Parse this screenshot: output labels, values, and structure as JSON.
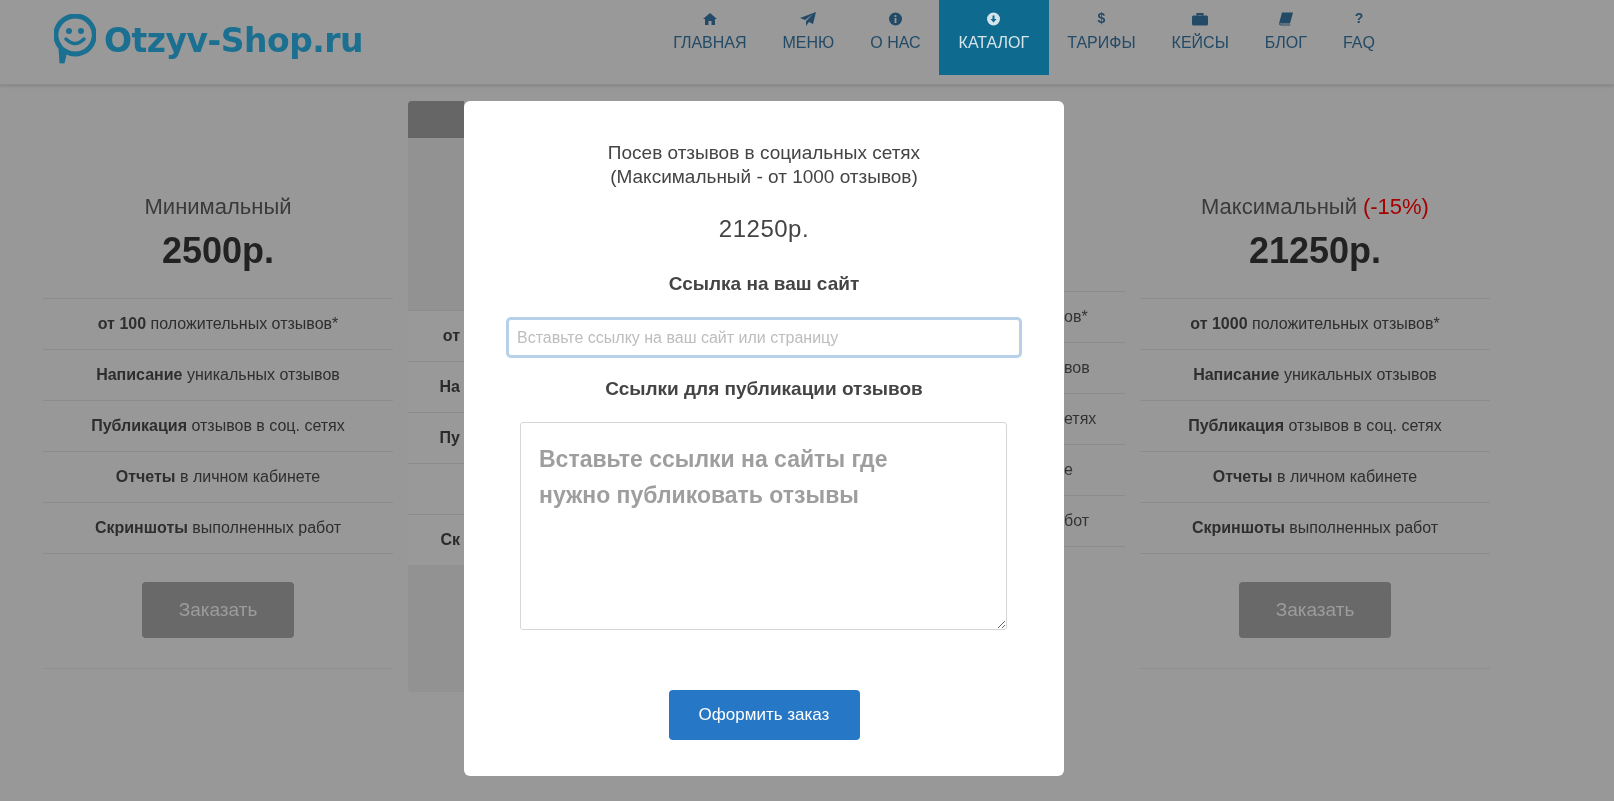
{
  "header": {
    "logo": "Otzyv-Shop.ru",
    "nav": [
      {
        "label": "ГЛАВНАЯ",
        "selected": false
      },
      {
        "label": "МЕНЮ",
        "selected": false
      },
      {
        "label": "О НАС",
        "selected": false
      },
      {
        "label": "КАТАЛОГ",
        "selected": true
      },
      {
        "label": "ТАРИФЫ",
        "selected": false,
        "glyph": "$"
      },
      {
        "label": "КЕЙСЫ",
        "selected": false
      },
      {
        "label": "БЛОГ",
        "selected": false
      },
      {
        "label": "FAQ",
        "selected": false,
        "glyph": "?"
      }
    ]
  },
  "cards": [
    {
      "kind": "full",
      "title": "Минимальный",
      "price": "2500р.",
      "features": [
        "**от 100** положительных отзывов*",
        "**Написание** уникальных отзывов",
        "**Публикация** отзывов в соц. сетях",
        "**Отчеты** в личном кабинете",
        "**Скриншоты** выполненных работ"
      ],
      "button": "Заказать"
    },
    {
      "kind": "partial-left",
      "rows": [
        {
          "text": "от"
        },
        {
          "text": "На"
        },
        {
          "text": "Пу"
        },
        {},
        {
          "text": "Ск"
        }
      ]
    },
    {
      "kind": "partial-right",
      "rows": [
        {
          "text": "ов*"
        },
        {
          "text": "вов"
        },
        {
          "text": "етях"
        },
        {
          "text": "е"
        },
        {
          "text": "бот"
        }
      ]
    },
    {
      "kind": "full",
      "title": "Максимальный",
      "discount": "(-15%)",
      "price": "21250р.",
      "features": [
        "**от 1000** положительных отзывов*",
        "**Написание** уникальных отзывов",
        "**Публикация** отзывов в соц. сетях",
        "**Отчеты** в личном кабинете",
        "**Скриншоты** выполненных работ"
      ],
      "button": "Заказать"
    }
  ],
  "modal": {
    "title": "Посев отзывов в социальных сетях\n(Максимальный - от 1000 отзывов)",
    "price": "21250р.",
    "site_label": "Ссылка на ваш сайт",
    "site_field": {
      "placeholder": "Вставьте ссылку на ваш сайт или страницу"
    },
    "links_label": "Ссылки для публикации отзывов",
    "links_field": {
      "placeholder": "Вставьте ссылки на сайты где нужно публиковать отзывы"
    },
    "submit": "Оформить заказ"
  }
}
